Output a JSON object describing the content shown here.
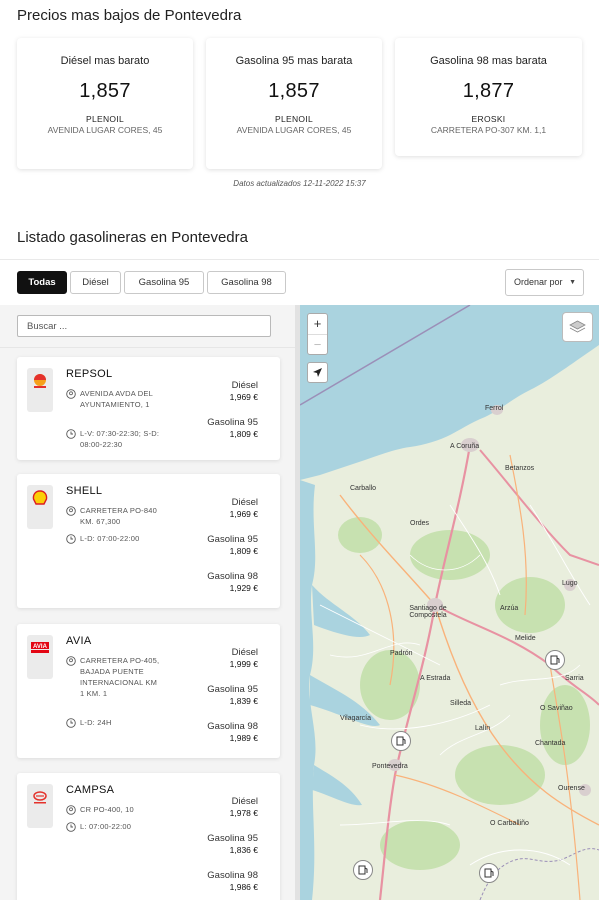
{
  "cheapest": {
    "title": "Precios mas bajos de Pontevedra",
    "cards": [
      {
        "label": "Diésel mas barato",
        "price": "1,857",
        "station": "PLENOIL",
        "address": "AVENIDA LUGAR CORES, 45"
      },
      {
        "label": "Gasolina 95 mas barata",
        "price": "1,857",
        "station": "PLENOIL",
        "address": "AVENIDA LUGAR CORES, 45"
      },
      {
        "label": "Gasolina 98 mas barata",
        "price": "1,877",
        "station": "EROSKI",
        "address": "CARRETERA PO-307 KM. 1,1"
      }
    ],
    "updated": "Datos actualizados 12-11-2022 15:37"
  },
  "listing": {
    "title": "Listado gasolineras en Pontevedra",
    "filters": [
      "Todas",
      "Diésel",
      "Gasolina 95",
      "Gasolina 98"
    ],
    "active_filter": "Todas",
    "sort_label": "Ordenar por",
    "search_placeholder": "Buscar ..."
  },
  "stations": [
    {
      "name": "REPSOL",
      "logo": "repsol-logo",
      "address": "AVENIDA AVDA DEL AYUNTAMIENTO, 1",
      "hours": "L-V: 07:30-22:30; S-D: 08:00-22:30",
      "prices": [
        {
          "fuel": "Diésel",
          "price": "1,969 €"
        },
        {
          "fuel": "Gasolina 95",
          "price": "1,809 €"
        }
      ]
    },
    {
      "name": "SHELL",
      "logo": "shell-logo",
      "address": "CARRETERA PO-840 KM. 67,300",
      "hours": "L-D: 07:00-22:00",
      "prices": [
        {
          "fuel": "Diésel",
          "price": "1,969 €"
        },
        {
          "fuel": "Gasolina 95",
          "price": "1,809 €"
        },
        {
          "fuel": "Gasolina 98",
          "price": "1,929 €"
        }
      ]
    },
    {
      "name": "AVIA",
      "logo": "avia-logo",
      "address": "CARRETERA PO-405, BAJADA PUENTE INTERNACIONAL KM 1 KM. 1",
      "hours": "L-D: 24H",
      "prices": [
        {
          "fuel": "Diésel",
          "price": "1,999 €"
        },
        {
          "fuel": "Gasolina 95",
          "price": "1,839 €"
        },
        {
          "fuel": "Gasolina 98",
          "price": "1,989 €"
        }
      ]
    },
    {
      "name": "CAMPSA",
      "logo": "campsa-logo",
      "address": "CR PO-400, 10",
      "hours": "L: 07:00-22:00",
      "prices": [
        {
          "fuel": "Diésel",
          "price": "1,978 €"
        },
        {
          "fuel": "Gasolina 95",
          "price": "1,836 €"
        },
        {
          "fuel": "Gasolina 98",
          "price": "1,986 €"
        }
      ]
    }
  ],
  "map": {
    "zoom_in": "+",
    "zoom_out": "−",
    "places": [
      "A Coruña",
      "Ferrol",
      "Santiago de Compostela",
      "Pontevedra",
      "Lugo",
      "Ourense",
      "Vilagarcía",
      "Carballo",
      "Arzúa",
      "A Estrada",
      "Lalín",
      "Sarria",
      "Melide",
      "Betanzos",
      "O Carballiño",
      "Silleda",
      "Padrón",
      "Ordes",
      "Chantada",
      "O Saviñao"
    ],
    "colors": {
      "sea": "#aad3df",
      "land": "#e9eedd",
      "motorway": "#e892a2",
      "road": "#f9b27a",
      "green": "#c7e1b0"
    }
  }
}
